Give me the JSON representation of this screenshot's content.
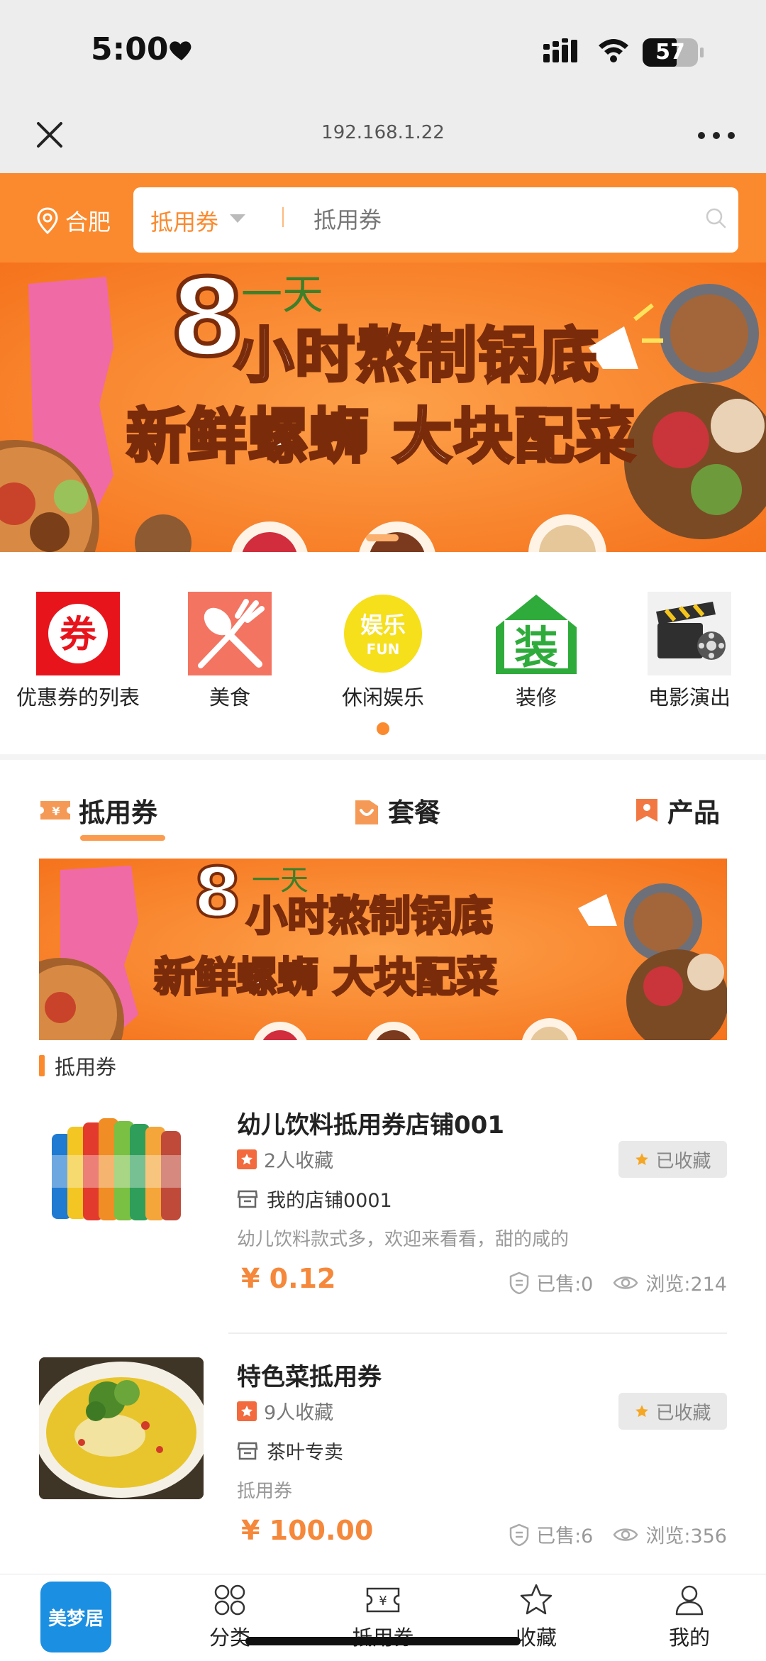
{
  "status_bar": {
    "time": "5:00",
    "battery": "57"
  },
  "browser": {
    "url": "192.168.1.22"
  },
  "header": {
    "location": "合肥",
    "search_type": "抵用券",
    "search_placeholder": "抵用券"
  },
  "categories": [
    {
      "label": "优惠券的列表",
      "icon": "coupon-icon"
    },
    {
      "label": "美食",
      "icon": "food-icon"
    },
    {
      "label": "休闲娱乐",
      "icon": "entertainment-icon"
    },
    {
      "label": "装修",
      "icon": "decoration-icon"
    },
    {
      "label": "电影演出",
      "icon": "movie-icon"
    }
  ],
  "banner_text": {
    "line_small": "一天",
    "digit": "8",
    "line1": "小时熬制锅底",
    "line2": "新鲜螺蛳 大块配菜"
  },
  "tabs": [
    {
      "label": "抵用券"
    },
    {
      "label": "套餐"
    },
    {
      "label": "产品"
    }
  ],
  "section_label": "抵用券",
  "products": [
    {
      "title": "幼儿饮料抵用券店铺001",
      "favorites": "2人收藏",
      "store": "我的店铺0001",
      "desc": "幼儿饮料款式多，欢迎来看看，甜的咸的",
      "price": "¥ 0.12",
      "collected": "已收藏",
      "sold": "已售:0",
      "views": "浏览:214"
    },
    {
      "title": "特色菜抵用券",
      "favorites": "9人收藏",
      "store": "茶叶专卖",
      "desc": "抵用券",
      "price": "¥ 100.00",
      "collected": "已收藏",
      "sold": "已售:6",
      "views": "浏览:356"
    }
  ],
  "bottom_nav": {
    "logo": "美梦居",
    "items": [
      {
        "label": "分类"
      },
      {
        "label": "抵用券"
      },
      {
        "label": "收藏"
      },
      {
        "label": "我的"
      }
    ]
  },
  "colors": {
    "accent": "#fb8a2e",
    "price": "#f5883a",
    "logo": "#1b8fe2"
  }
}
